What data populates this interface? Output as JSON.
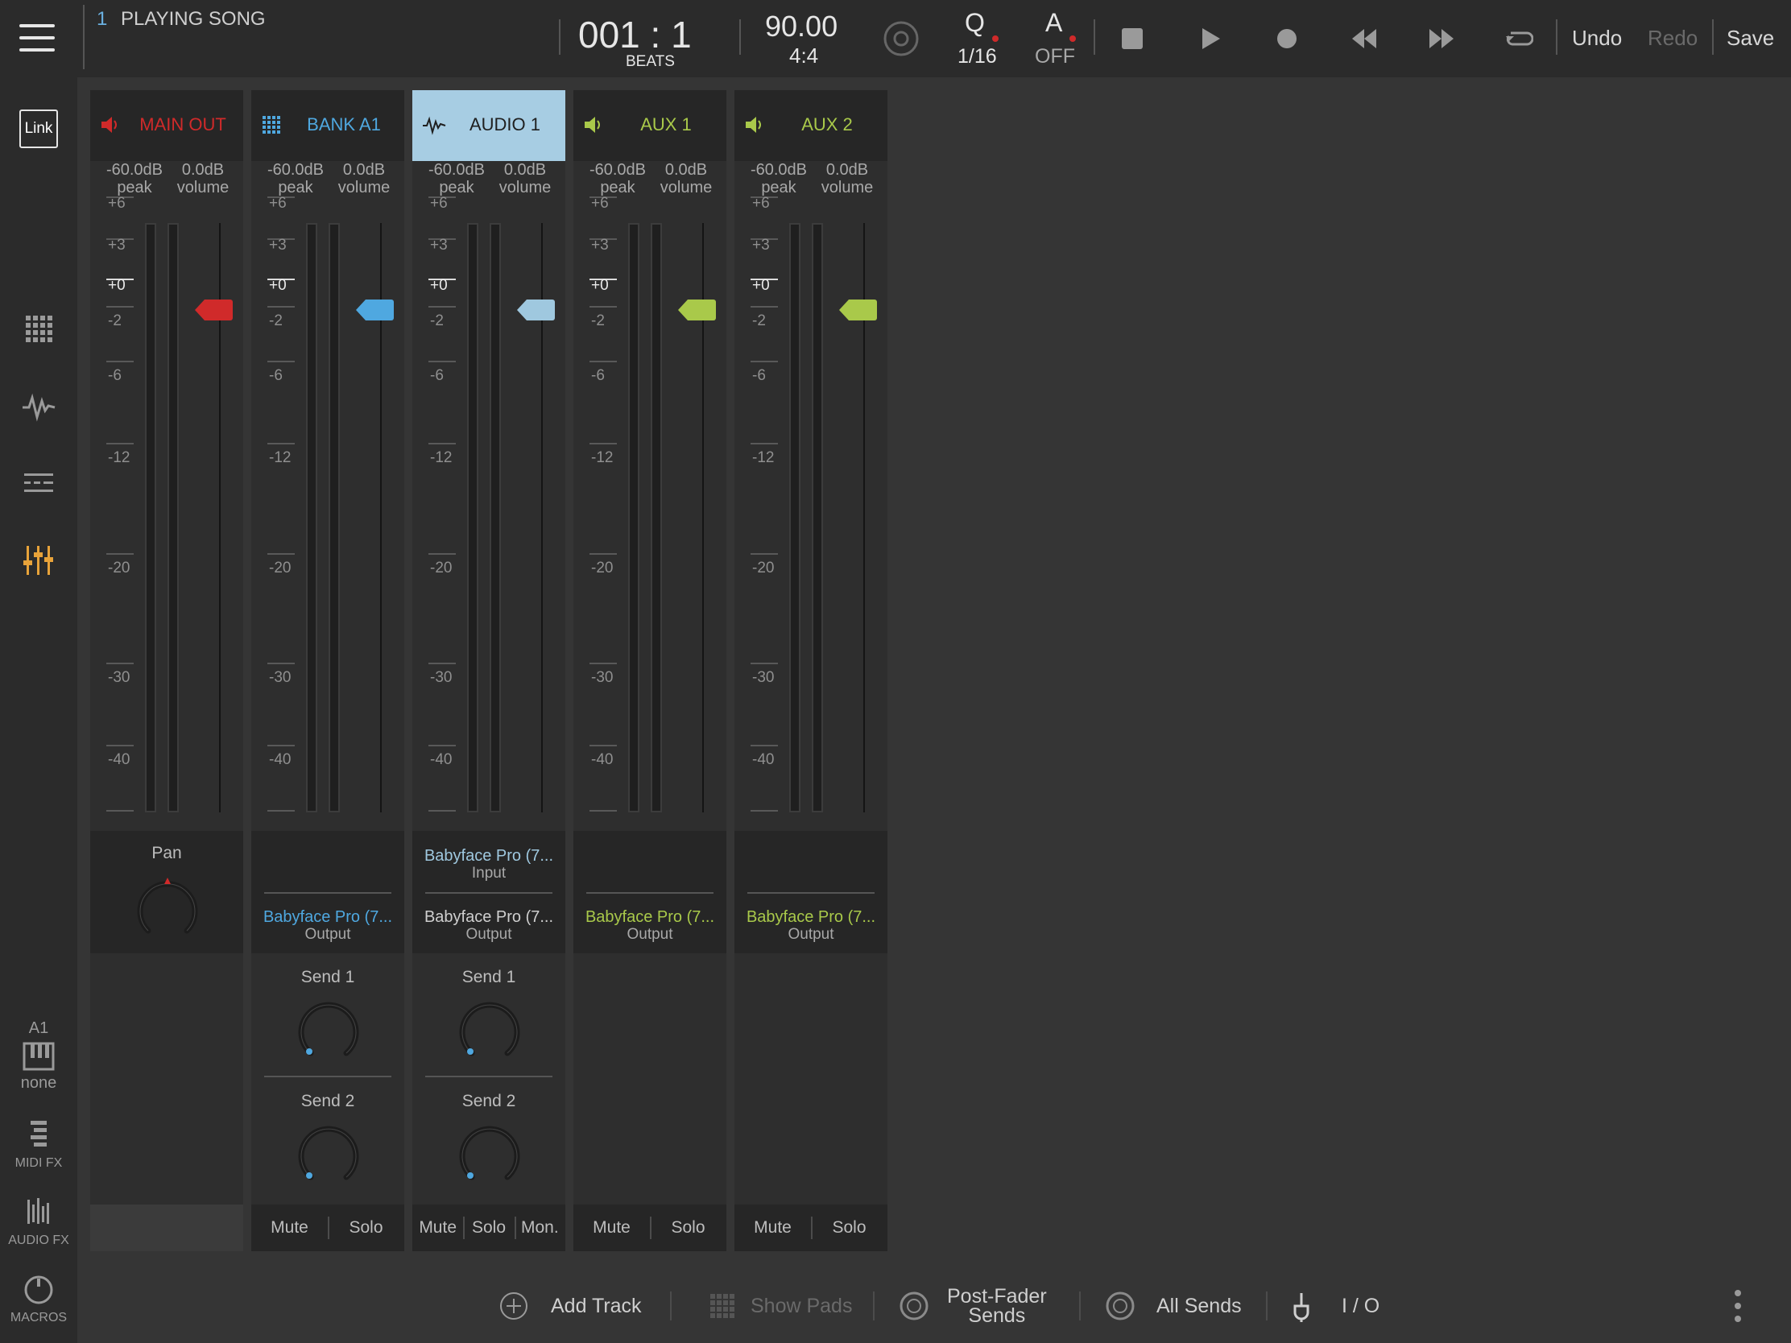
{
  "topbar": {
    "song_number": "1",
    "song_title": "PLAYING SONG",
    "position": "001 : 1",
    "position_unit": "BEATS",
    "tempo": "90.00",
    "signature": "4:4",
    "quantize_label": "Q",
    "quantize_value": "1/16",
    "automation_label": "A",
    "automation_value": "OFF",
    "undo": "Undo",
    "redo": "Redo",
    "save": "Save"
  },
  "sidebar": {
    "link_label": "Link",
    "keyboard_bank": "A1",
    "keyboard_value": "none",
    "midi_fx": "MIDI FX",
    "audio_fx": "AUDIO FX",
    "macros": "MACROS"
  },
  "scale_labels": [
    "+6",
    "+3",
    "+0",
    "-2",
    "-6",
    "-12",
    "-20",
    "-30",
    "-40"
  ],
  "strips": [
    {
      "name": "MAIN OUT",
      "color": "#d02a2a",
      "icon": "speaker-icon",
      "peak": "-60.0dB",
      "peak_label": "peak",
      "volume": "0.0dB",
      "volume_label": "volume",
      "pan_label": "Pan",
      "buttons": []
    },
    {
      "name": "BANK A1",
      "color": "#4fa8e0",
      "icon": "pad-grid-icon",
      "peak": "-60.0dB",
      "peak_label": "peak",
      "volume": "0.0dB",
      "volume_label": "volume",
      "output": "Babyface Pro (7...",
      "output_label": "Output",
      "send1": "Send 1",
      "send2": "Send 2",
      "buttons": [
        "Mute",
        "Solo"
      ]
    },
    {
      "name": "AUDIO 1",
      "color": "#9fc8df",
      "icon": "waveform-icon",
      "peak": "-60.0dB",
      "peak_label": "peak",
      "volume": "0.0dB",
      "volume_label": "volume",
      "input": "Babyface Pro (7...",
      "input_label": "Input",
      "output": "Babyface Pro (7...",
      "output_label": "Output",
      "send1": "Send 1",
      "send2": "Send 2",
      "buttons": [
        "Mute",
        "Solo",
        "Mon."
      ]
    },
    {
      "name": "AUX 1",
      "color": "#a9c94a",
      "icon": "speaker-icon",
      "peak": "-60.0dB",
      "peak_label": "peak",
      "volume": "0.0dB",
      "volume_label": "volume",
      "output": "Babyface Pro (7...",
      "output_label": "Output",
      "buttons": [
        "Mute",
        "Solo"
      ]
    },
    {
      "name": "AUX 2",
      "color": "#a9c94a",
      "icon": "speaker-icon",
      "peak": "-60.0dB",
      "peak_label": "peak",
      "volume": "0.0dB",
      "volume_label": "volume",
      "output": "Babyface Pro (7...",
      "output_label": "Output",
      "buttons": [
        "Mute",
        "Solo"
      ]
    }
  ],
  "bottombar": {
    "add_track": "Add Track",
    "show_pads": "Show Pads",
    "post_fader_line1": "Post-Fader",
    "post_fader_line2": "Sends",
    "all_sends": "All Sends",
    "io": "I / O"
  }
}
